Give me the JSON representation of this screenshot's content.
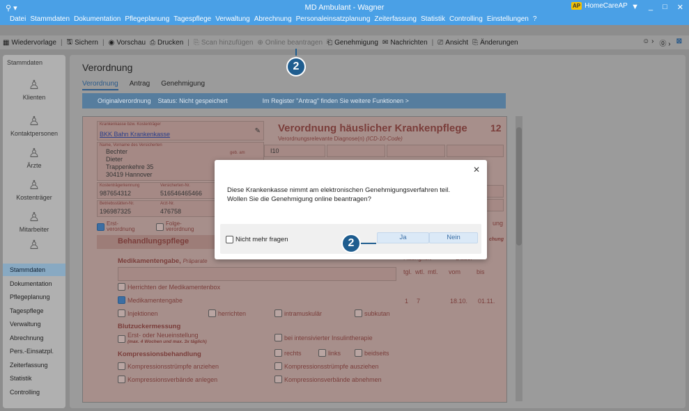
{
  "window": {
    "title": "MD Ambulant - Wagner",
    "app_badge": "AP",
    "app_name": "HomeCareAP",
    "search_icon": "search-icon"
  },
  "menu": [
    "Datei",
    "Stammdaten",
    "Dokumentation",
    "Pflegeplanung",
    "Tagespflege",
    "Verwaltung",
    "Abrechnung",
    "Personaleinsatzplanung",
    "Zeiterfassung",
    "Statistik",
    "Controlling",
    "Einstellungen",
    "?"
  ],
  "toolbar": {
    "wiedervorlage": "Wiedervorlage",
    "sichern": "Sichern",
    "vorschau": "Vorschau",
    "drucken": "Drucken",
    "scan": "Scan hinzufügen",
    "online": "Online beantragen",
    "genehmigung": "Genehmigung",
    "nachrichten": "Nachrichten",
    "ansicht": "Ansicht",
    "aenderungen": "Änderungen"
  },
  "sidebar": {
    "header": "Stammdaten",
    "items": [
      "Klienten",
      "Kontaktpersonen",
      "Ärzte",
      "Kostenträger",
      "Mitarbeiter"
    ],
    "nav": [
      "Stammdaten",
      "Dokumentation",
      "Pflegeplanung",
      "Tagespflege",
      "Verwaltung",
      "Abrechnung",
      "Pers.-Einsatzpl.",
      "Zeiterfassung",
      "Statistik",
      "Controlling"
    ]
  },
  "page": {
    "title": "Verordnung",
    "tabs": [
      "Verordnung",
      "Antrag",
      "Genehmigung"
    ],
    "info_left": "Originalverordnung",
    "info_status": "Status: Nicht gespeichert",
    "info_right": "Im Register \"Antrag\" finden Sie weitere Funktionen >"
  },
  "form": {
    "kasse_label": "Krankenkasse bzw. Kostenträger",
    "kasse": "BKK Bahn Krankenkasse",
    "name_label": "Name, Vorname des Versicherten",
    "name1": "Bechter",
    "name2": "Dieter",
    "street": "Trappenkehre 35",
    "city": "30419 Hannover",
    "geb": "geb. am",
    "kt_label": "Kostenträgerkennung",
    "kt": "987654312",
    "vers_label": "Versicherten-Nr.",
    "vers": "516546465466",
    "bs_label": "Betriebsstätten-Nr.",
    "bs": "196987325",
    "arzt_label": "Arzt-Nr.",
    "arzt": "476758",
    "title": "Verordnung häuslicher Krankenpflege",
    "number": "12",
    "diag_label": "Verordnungsrelevante Diagnose(n)",
    "diag_code": "(ICD-10-Code)",
    "diag": "I10",
    "erst1": "Erst-",
    "erst2": "verordnung",
    "folge1": "Folge-",
    "folge2": "verordnung",
    "behandlung": "Behandlungspflege",
    "medigabe": "Medikamentengabe,",
    "praeparate": "Präparate",
    "haeufigkeit": "Häufigkeit",
    "dauer": "Dauer",
    "cols": [
      "tgl.",
      "wtl.",
      "mtl.",
      "vom",
      "bis"
    ],
    "row_values": [
      "1",
      "7",
      "",
      "18.10.",
      "01.11."
    ],
    "items": [
      "Herrichten der Medikamentenbox",
      "Medikamentengabe",
      "Injektionen",
      "herrichten",
      "intramuskulär",
      "subkutan"
    ],
    "bz": "Blutzuckermessung",
    "bz1": "Erst- oder Neueinstellung",
    "bz1b": "(max. 4 Wochen und max. 3x täglich)",
    "bz2": "bei intensivierter Insulintherapie",
    "komp": "Kompressionsbehandlung",
    "rechts": "rechts",
    "links": "links",
    "beidseits": "beidseits",
    "k1": "Kompressionsstrümpfe anziehen",
    "k2": "Kompressionsstrümpfe ausziehen",
    "k3": "Kompressionsverbände anlegen",
    "k4": "Kompressionsverbände abnehmen",
    "right_frag1": "ung",
    "right_frag2": "chung",
    "right_frag3": "ung"
  },
  "dialog": {
    "line1": "Diese Krankenkasse nimmt am elektronischen Genehmigungsverfahren teil.",
    "line2": "Wollen Sie die Genehmigung online beantragen?",
    "checkbox": "Nicht mehr fragen",
    "yes": "Ja",
    "no": "Nein"
  },
  "badges": [
    "2",
    "2"
  ],
  "colors": {
    "accent": "#4aa0e6",
    "badge": "#1f5d8f"
  }
}
